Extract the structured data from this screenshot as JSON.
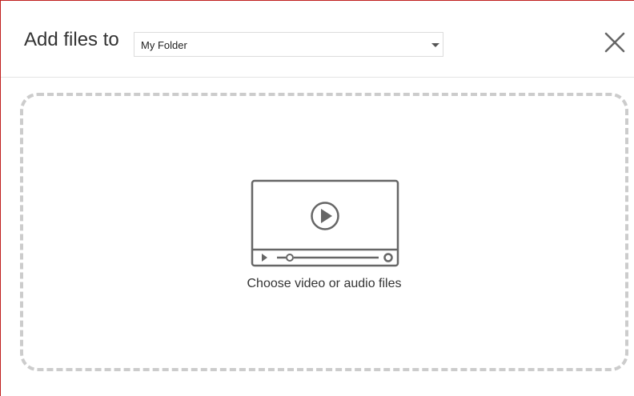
{
  "header": {
    "title": "Add files to",
    "folder_select": {
      "value": "My Folder"
    }
  },
  "dropzone": {
    "label": "Choose video or audio files"
  },
  "icons": {
    "close": "close-icon",
    "caret": "chevron-down-icon",
    "media": "video-player-icon"
  },
  "colors": {
    "dialog_border": "#c0201f",
    "dropzone_border": "#cccccc",
    "icon_stroke": "#666666",
    "text": "#333333"
  }
}
